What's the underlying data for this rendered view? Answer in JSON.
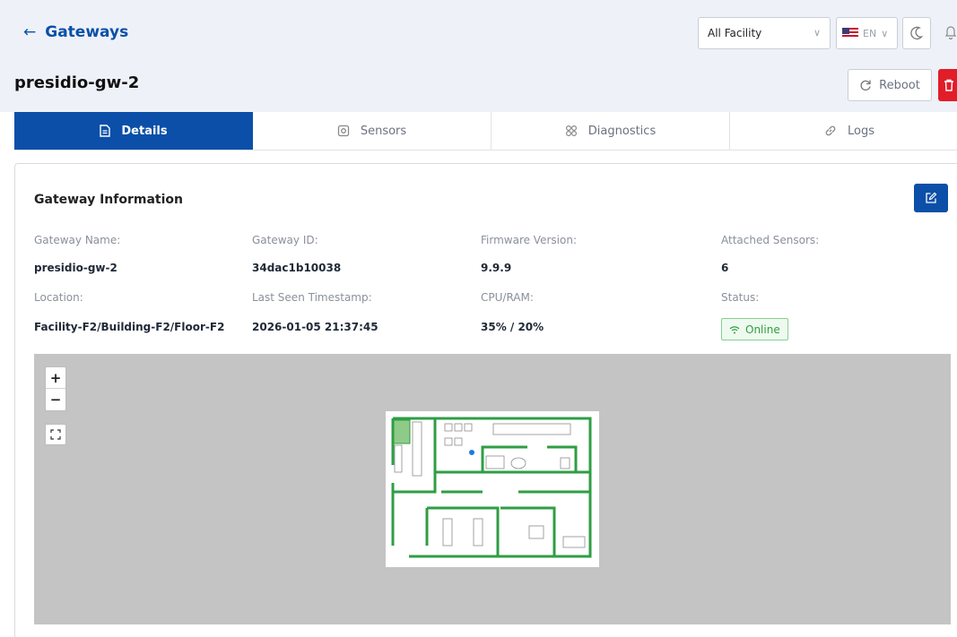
{
  "header": {
    "back_label": "Gateways",
    "facility_select": {
      "value": "All Facility"
    },
    "language": {
      "value": "EN"
    },
    "page_title": "presidio-gw-2",
    "reboot_label": "Reboot"
  },
  "tabs": [
    {
      "label": "Details",
      "icon": "document-icon",
      "active": true
    },
    {
      "label": "Sensors",
      "icon": "sensor-icon",
      "active": false
    },
    {
      "label": "Diagnostics",
      "icon": "diagnostics-icon",
      "active": false
    },
    {
      "label": "Logs",
      "icon": "link-icon",
      "active": false
    }
  ],
  "gateway_info": {
    "title": "Gateway Information",
    "fields": {
      "name": {
        "label": "Gateway Name:",
        "value": "presidio-gw-2"
      },
      "id": {
        "label": "Gateway ID:",
        "value": "34dac1b10038"
      },
      "firmware": {
        "label": "Firmware Version:",
        "value": "9.9.9"
      },
      "sensors": {
        "label": "Attached Sensors:",
        "value": "6"
      },
      "location": {
        "label": "Location:",
        "value": "Facility-F2/Building-F2/Floor-F2"
      },
      "last_seen": {
        "label": "Last Seen Timestamp:",
        "value": "2026-01-05 21:37:45"
      },
      "cpu_ram": {
        "label": "CPU/RAM:",
        "value": "35% / 20%"
      },
      "status": {
        "label": "Status:",
        "value": "Online"
      }
    }
  },
  "map": {
    "zoom_in": "+",
    "zoom_out": "−"
  },
  "colors": {
    "primary": "#0b4fa8",
    "header_bg": "#eef2f8",
    "danger": "#e11d2a",
    "online": "#2e9e3f",
    "map_bg": "#c4c4c4",
    "floorplan_walls": "#2f9e44"
  }
}
